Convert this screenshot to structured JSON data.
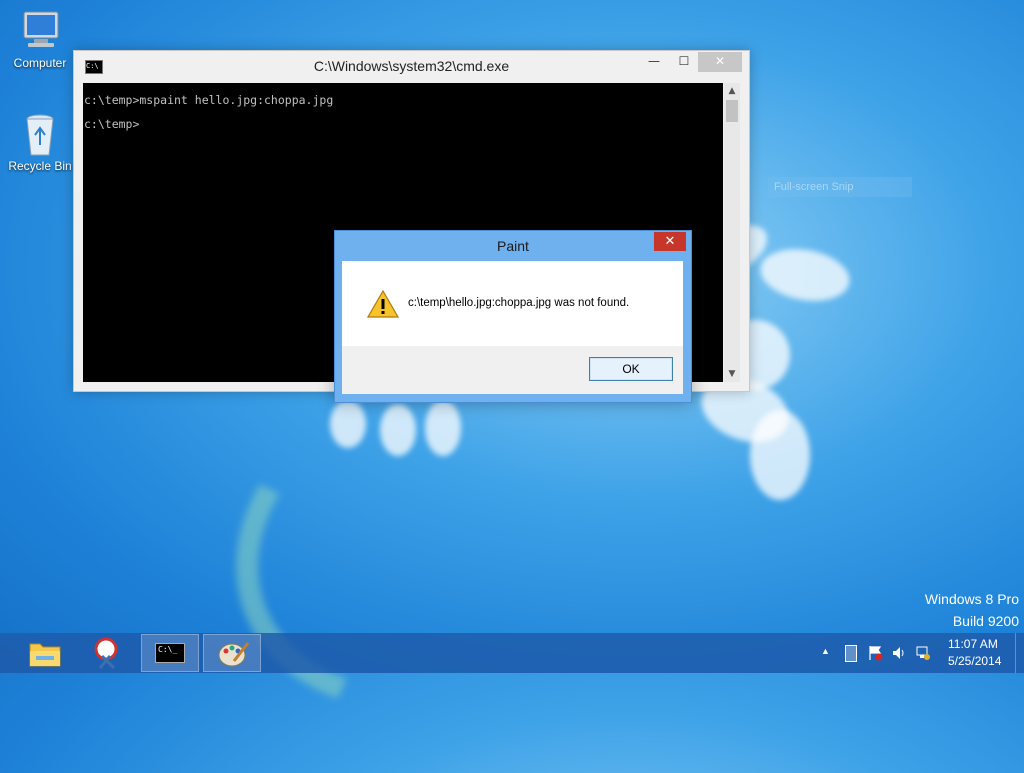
{
  "desktop": {
    "icons": [
      {
        "label": "Computer"
      },
      {
        "label": "Recycle Bin"
      }
    ],
    "ghost_tooltip": "Full-screen Snip"
  },
  "cmd_window": {
    "title": "C:\\Windows\\system32\\cmd.exe",
    "lines": [
      "c:\\temp>mspaint hello.jpg:choppa.jpg",
      "c:\\temp>"
    ],
    "controls": {
      "minimize": "—",
      "maximize": "☐",
      "close": "✕"
    }
  },
  "dialog": {
    "title": "Paint",
    "message": "c:\\temp\\hello.jpg:choppa.jpg was not found.",
    "ok_label": "OK",
    "close_symbol": "✕"
  },
  "watermark": {
    "line1": "Windows 8 Pro",
    "line2": "Build 9200"
  },
  "taskbar": {
    "apps": [
      {
        "name": "file-explorer-icon"
      },
      {
        "name": "snipping-tool-icon"
      },
      {
        "name": "command-prompt-icon"
      },
      {
        "name": "paint-icon"
      }
    ],
    "cmd_icon_text": "C:\\_",
    "tray": {
      "show_hidden": "▲",
      "time": "11:07 AM",
      "date": "5/25/2014"
    }
  },
  "colors": {
    "desktop_blue": "#1e82d8",
    "dialog_frame": "#6fb0ee",
    "close_red": "#c7362b",
    "console_bg": "#000000"
  }
}
